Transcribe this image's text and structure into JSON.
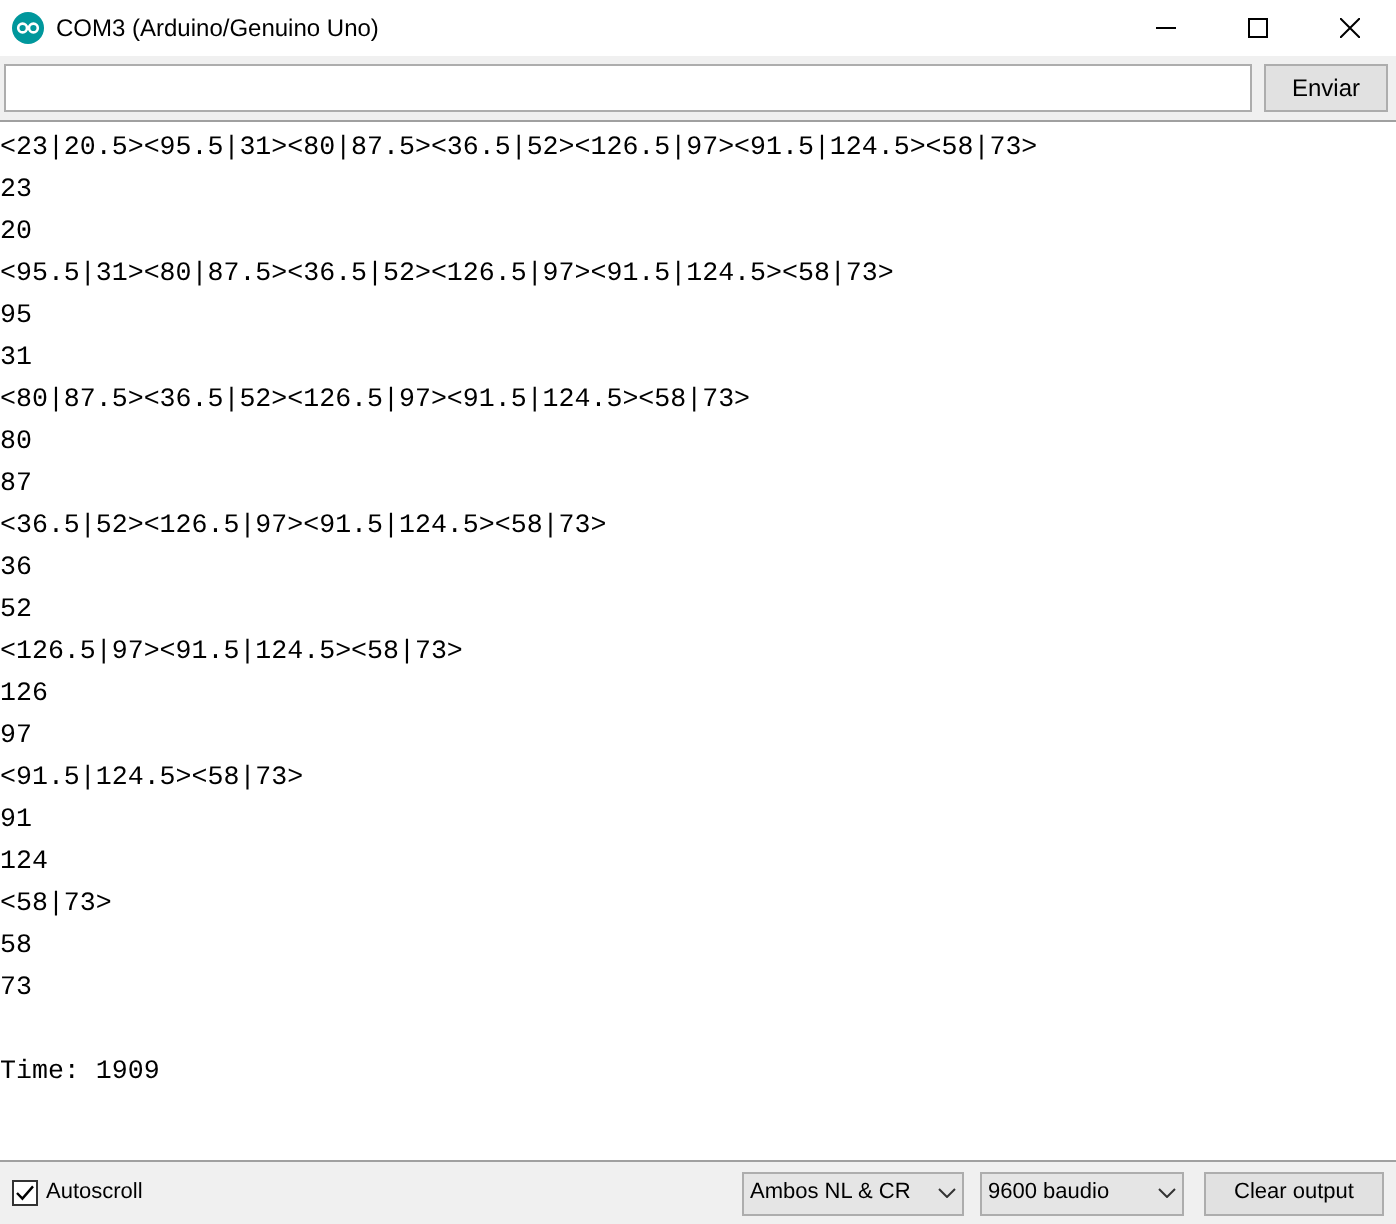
{
  "window": {
    "title": "COM3 (Arduino/Genuino Uno)"
  },
  "send_bar": {
    "button": "Enviar"
  },
  "output": [
    {
      "text": "<23|20.5><95.5|31><80|87.5><36.5|52><126.5|97><91.5|124.5><58|73>"
    },
    {
      "text": "23"
    },
    {
      "text": "20"
    },
    {
      "text": "<95.5|31><80|87.5><36.5|52><126.5|97><91.5|124.5><58|73>"
    },
    {
      "text": "95"
    },
    {
      "text": "31"
    },
    {
      "text": "<80|87.5><36.5|52><126.5|97><91.5|124.5><58|73>"
    },
    {
      "text": "80"
    },
    {
      "text": "87"
    },
    {
      "text": "<36.5|52><126.5|97><91.5|124.5><58|73>"
    },
    {
      "text": "36"
    },
    {
      "text": "52"
    },
    {
      "text": "<126.5|97><91.5|124.5><58|73>"
    },
    {
      "text": "126"
    },
    {
      "text": "97"
    },
    {
      "text": "<91.5|124.5><58|73>"
    },
    {
      "text": "91"
    },
    {
      "text": "124"
    },
    {
      "text": "<58|73>"
    },
    {
      "text": "58"
    },
    {
      "text": "73"
    },
    {
      "kind": "blank"
    },
    {
      "text": "Time: 1909"
    }
  ],
  "status_bar": {
    "autoscroll": {
      "label": "Autoscroll",
      "checked": true
    },
    "line_ending": "Ambos NL & CR",
    "baud_rate": "9600 baudio",
    "clear_button": "Clear output"
  }
}
